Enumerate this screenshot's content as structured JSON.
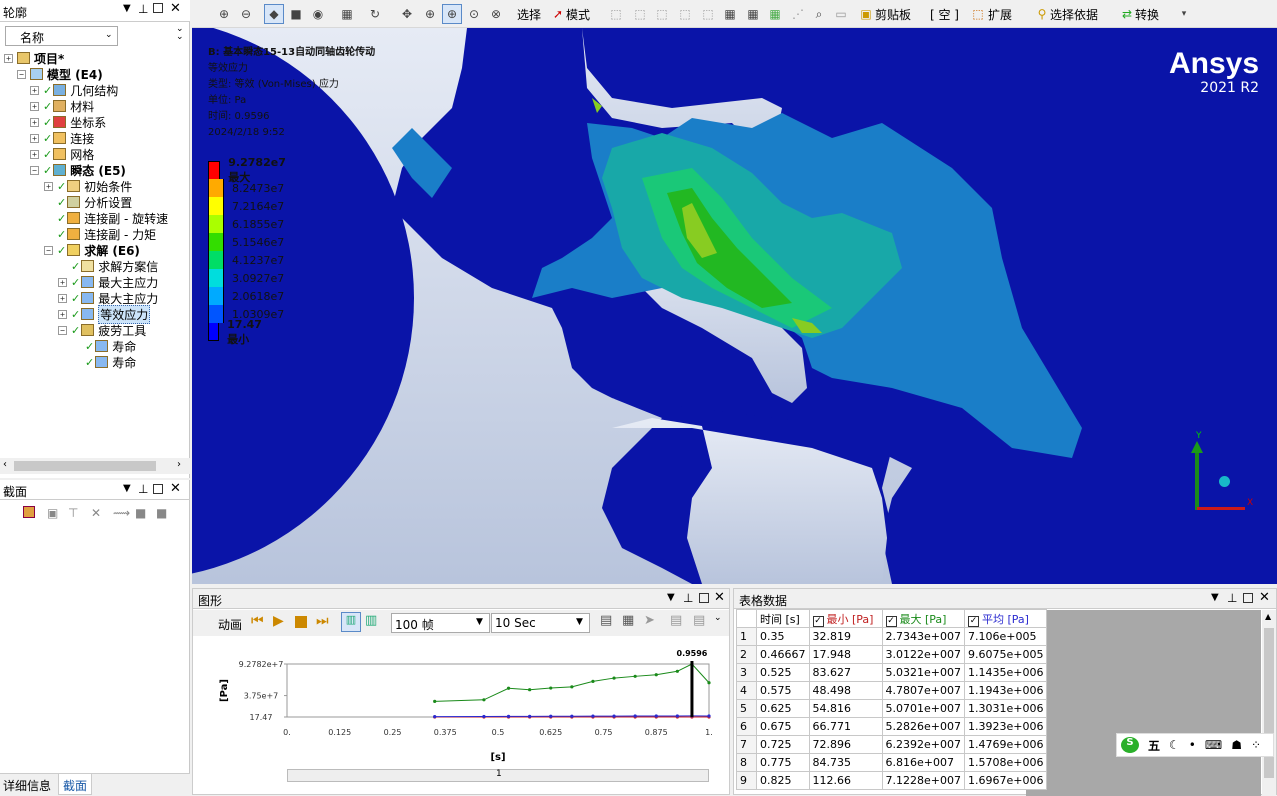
{
  "outline": {
    "title": "轮廓",
    "filter_label": "名称",
    "tree": [
      {
        "label": "项目*",
        "bold": true
      },
      {
        "label": "模型 (E4)",
        "bold": true
      },
      {
        "label": "几何结构"
      },
      {
        "label": "材料"
      },
      {
        "label": "坐标系"
      },
      {
        "label": "连接"
      },
      {
        "label": "网格"
      },
      {
        "label": "瞬态 (E5)",
        "bold": true
      },
      {
        "label": "初始条件"
      },
      {
        "label": "分析设置"
      },
      {
        "label": "连接副 - 旋转速"
      },
      {
        "label": "连接副 - 力矩"
      },
      {
        "label": "求解 (E6)",
        "bold": true
      },
      {
        "label": "求解方案信"
      },
      {
        "label": "最大主应力"
      },
      {
        "label": "最大主应力"
      },
      {
        "label": "等效应力"
      },
      {
        "label": "疲劳工具"
      },
      {
        "label": "寿命"
      },
      {
        "label": "寿命"
      }
    ]
  },
  "section": {
    "title": "截面"
  },
  "bottom_tabs": [
    "详细信息",
    "截面"
  ],
  "toolbar": {
    "select_label": "选择",
    "mode_label": "模式",
    "clipboard_label": "剪贴板",
    "empty_label": "[ 空 ]",
    "extend_label": "扩展",
    "select_by_label": "选择依据",
    "convert_label": "转换"
  },
  "viewport": {
    "header_title": "B: 基本瞬态15-13自动同轴齿轮传动",
    "result_name": "等效应力",
    "type_line": "类型: 等效 (Von-Mises) 应力",
    "unit_line": "单位: Pa",
    "time_line": "时间: 0.9596",
    "date_line": "2024/2/18 9:52",
    "brand": "Ansys",
    "version": "2021 R2",
    "axis_y": "Y",
    "axis_x": "X",
    "legend": [
      {
        "label": "9.2782e7 最大",
        "color": "#ff0000",
        "bold": true
      },
      {
        "label": "8.2473e7",
        "color": "#ffaa00"
      },
      {
        "label": "7.2164e7",
        "color": "#ffff00"
      },
      {
        "label": "6.1855e7",
        "color": "#aaff00"
      },
      {
        "label": "5.1546e7",
        "color": "#33dd00"
      },
      {
        "label": "4.1237e7",
        "color": "#00dd66"
      },
      {
        "label": "3.0927e7",
        "color": "#00dddd"
      },
      {
        "label": "2.0618e7",
        "color": "#00aaff"
      },
      {
        "label": "1.0309e7",
        "color": "#0055ff"
      },
      {
        "label": "17.47 最小",
        "color": "#0000ff",
        "bold": true
      }
    ]
  },
  "graph_panel": {
    "title": "图形",
    "animation_label": "动画",
    "frames": "100 帧",
    "duration": "10 Sec",
    "ylabel": "[Pa]",
    "xlabel": "[s]",
    "marker_label": "0.9596",
    "slider_label": "1"
  },
  "chart_data": {
    "type": "line",
    "xlabel": "[s]",
    "ylabel": "[Pa]",
    "xlim": [
      0,
      1
    ],
    "y_ticks": [
      "9.2782e+7",
      "3.75e+7",
      "17.47"
    ],
    "x_ticks": [
      "0.",
      "0.125",
      "0.25",
      "0.375",
      "0.5",
      "0.625",
      "0.75",
      "0.875",
      "1."
    ],
    "current_time": 0.9596,
    "x": [
      0.35,
      0.46667,
      0.525,
      0.575,
      0.625,
      0.675,
      0.725,
      0.775,
      0.825,
      0.875,
      0.925,
      0.9596,
      1.0
    ],
    "series": [
      {
        "name": "最大 [Pa]",
        "color": "#1a8a1a",
        "values": [
          27343000,
          30122000,
          50321000,
          47807000,
          50701000,
          52826000,
          62392000,
          68160000,
          71228000,
          74000000,
          80000000,
          92782000,
          60000000
        ]
      },
      {
        "name": "最小 [Pa]",
        "color": "#cc2222",
        "values": [
          32.819,
          17.948,
          83.627,
          48.498,
          54.816,
          66.771,
          72.896,
          84.735,
          112.66,
          90,
          80,
          17.47,
          60
        ]
      },
      {
        "name": "平均 [Pa]",
        "color": "#2a2ad0",
        "values": [
          710600,
          960750,
          1143500,
          1194300,
          1303100,
          1392300,
          1476900,
          1570800,
          1696700,
          1750000,
          1800000,
          1900000,
          1850000
        ]
      }
    ]
  },
  "table_panel": {
    "title": "表格数据",
    "headers": [
      "",
      "时间 [s]",
      "最小 [Pa]",
      "最大 [Pa]",
      "平均 [Pa]"
    ],
    "rows": [
      [
        "1",
        "0.35",
        "32.819",
        "2.7343e+007",
        "7.106e+005"
      ],
      [
        "2",
        "0.46667",
        "17.948",
        "3.0122e+007",
        "9.6075e+005"
      ],
      [
        "3",
        "0.525",
        "83.627",
        "5.0321e+007",
        "1.1435e+006"
      ],
      [
        "4",
        "0.575",
        "48.498",
        "4.7807e+007",
        "1.1943e+006"
      ],
      [
        "5",
        "0.625",
        "54.816",
        "5.0701e+007",
        "1.3031e+006"
      ],
      [
        "6",
        "0.675",
        "66.771",
        "5.2826e+007",
        "1.3923e+006"
      ],
      [
        "7",
        "0.725",
        "72.896",
        "6.2392e+007",
        "1.4769e+006"
      ],
      [
        "8",
        "0.775",
        "84.735",
        "6.816e+007",
        "1.5708e+006"
      ],
      [
        "9",
        "0.825",
        "112.66",
        "7.1228e+007",
        "1.6967e+006"
      ]
    ]
  },
  "ime": {
    "label": "五"
  }
}
